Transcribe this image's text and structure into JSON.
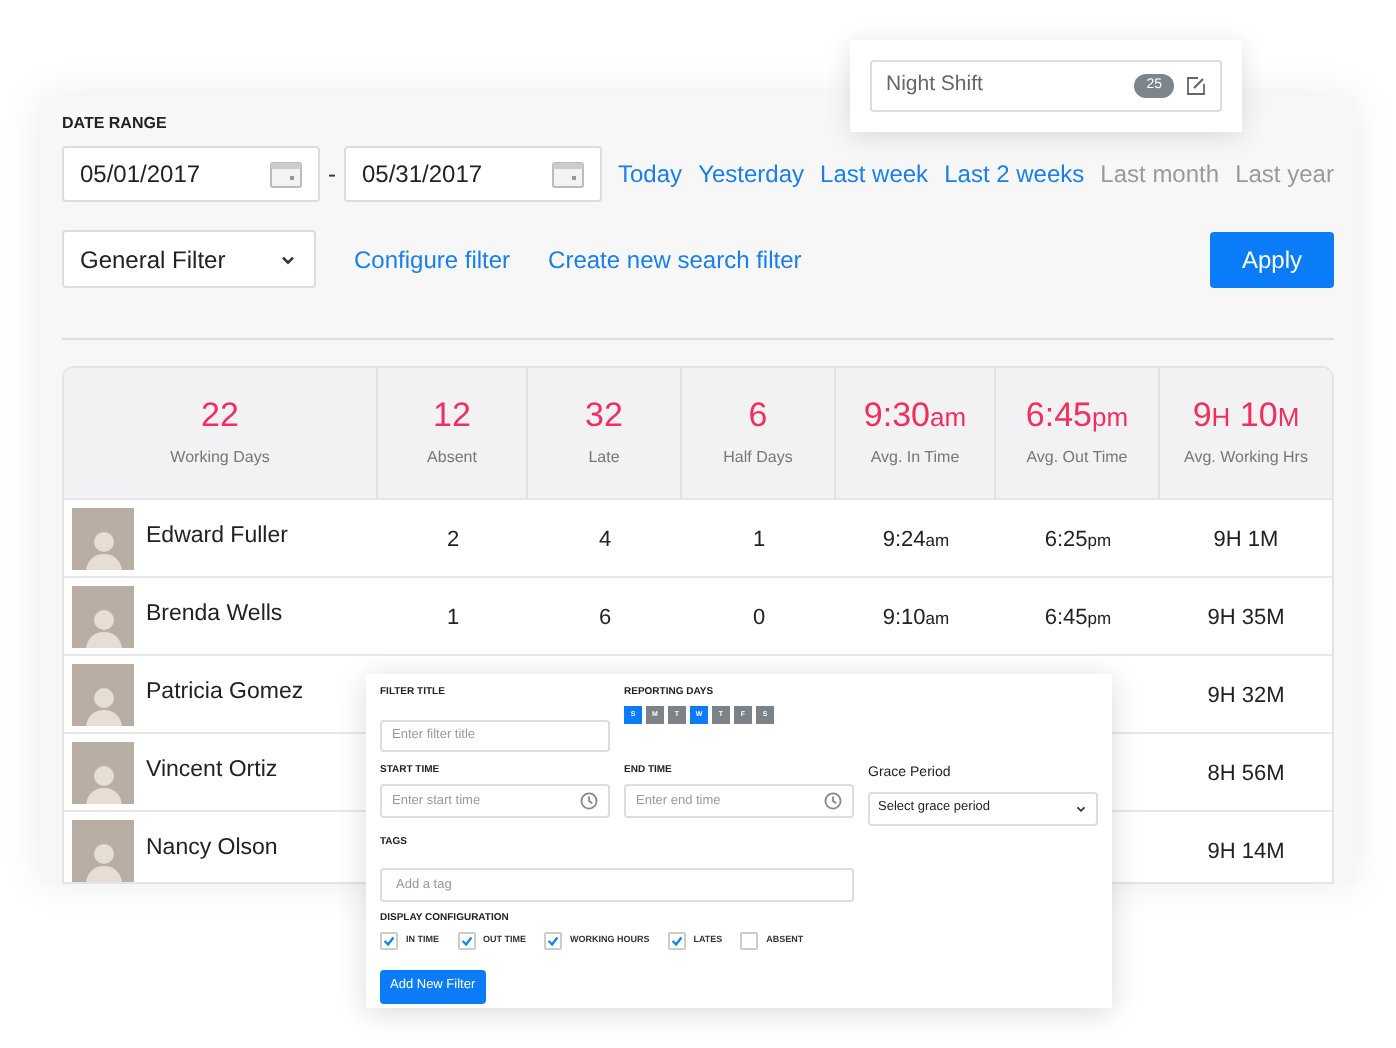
{
  "shift_popup": {
    "title": "Night Shift",
    "count": "25"
  },
  "date_range": {
    "label": "DATE RANGE",
    "start": "05/01/2017",
    "separator": "-",
    "end": "05/31/2017",
    "presets": [
      {
        "label": "Today",
        "disabled": false
      },
      {
        "label": "Yesterday",
        "disabled": false
      },
      {
        "label": "Last week",
        "disabled": false
      },
      {
        "label": "Last 2 weeks",
        "disabled": false
      },
      {
        "label": "Last month",
        "disabled": true
      },
      {
        "label": "Last year",
        "disabled": true
      }
    ]
  },
  "filter": {
    "selected": "General Filter",
    "links": [
      "Configure filter",
      "Create new search filter"
    ],
    "apply": "Apply"
  },
  "stats": [
    {
      "parts": [
        "22"
      ],
      "label": "Working Days"
    },
    {
      "parts": [
        "12"
      ],
      "label": "Absent"
    },
    {
      "parts": [
        "32"
      ],
      "label": "Late"
    },
    {
      "parts": [
        "6"
      ],
      "label": "Half Days"
    },
    {
      "parts": [
        "9:30",
        "am"
      ],
      "label": "Avg. In Time"
    },
    {
      "parts": [
        "6:45",
        "pm"
      ],
      "label": "Avg. Out Time"
    },
    {
      "parts": [
        "9",
        "H",
        " 10",
        "M"
      ],
      "label": "Avg. Working Hrs"
    }
  ],
  "rows": [
    {
      "name": "Edward Fuller",
      "cells": [
        [
          "2"
        ],
        [
          "4"
        ],
        [
          "1"
        ],
        [
          "9:24",
          "am"
        ],
        [
          "6:25",
          "pm"
        ],
        [
          "9H 1M"
        ]
      ]
    },
    {
      "name": "Brenda Wells",
      "cells": [
        [
          "1"
        ],
        [
          "6"
        ],
        [
          "0"
        ],
        [
          "9:10",
          "am"
        ],
        [
          "6:45",
          "pm"
        ],
        [
          "9H 35M"
        ]
      ]
    },
    {
      "name": "Patricia Gomez",
      "cells": [
        [
          "9H 32M"
        ]
      ]
    },
    {
      "name": "Vincent Ortiz",
      "cells": [
        [
          "8H 56M"
        ]
      ]
    },
    {
      "name": "Nancy Olson",
      "cells": [
        [
          "9H 14M"
        ]
      ]
    }
  ],
  "new_filter": {
    "title_label": "FILTER TITLE",
    "title_placeholder": "Enter filter title",
    "days_label": "REPORTING DAYS",
    "days": [
      {
        "label": "S",
        "selected": true
      },
      {
        "label": "M",
        "selected": false
      },
      {
        "label": "T",
        "selected": false
      },
      {
        "label": "W",
        "selected": true
      },
      {
        "label": "T",
        "selected": false
      },
      {
        "label": "F",
        "selected": false
      },
      {
        "label": "S",
        "selected": false
      }
    ],
    "start_label": "START TIME",
    "start_placeholder": "Enter start time",
    "end_label": "END TIME",
    "end_placeholder": "Enter end time",
    "grace_label": "Grace Period",
    "grace_placeholder": "Select grace period",
    "tags_label": "TAGS",
    "tags_placeholder": "Add a tag",
    "display_label": "DISPLAY CONFIGURATION",
    "options": [
      {
        "label": "IN TIME",
        "checked": true
      },
      {
        "label": "OUT TIME",
        "checked": true
      },
      {
        "label": "WORKING HOURS",
        "checked": true
      },
      {
        "label": "LATES",
        "checked": true
      },
      {
        "label": "ABSENT",
        "checked": false
      }
    ],
    "submit": "Add New Filter"
  }
}
